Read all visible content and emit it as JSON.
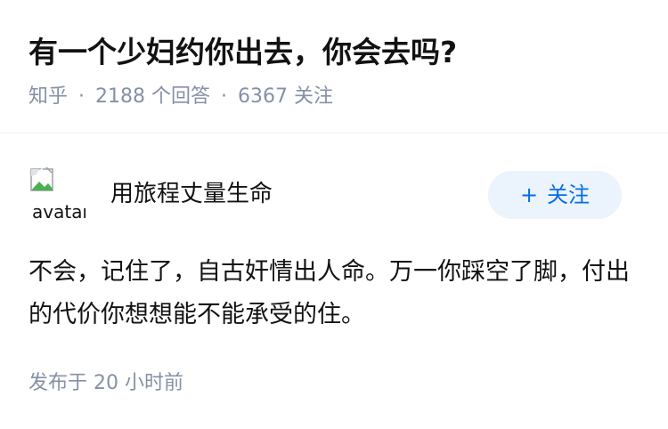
{
  "question": {
    "title": "有一个少妇约你出去，你会去吗?",
    "source": "知乎",
    "separator": "·",
    "answers_count": "2188",
    "answers_label": "个回答",
    "followers_count": "6367",
    "followers_label": "关注"
  },
  "answer": {
    "author": {
      "name": "用旅程丈量生命",
      "avatar_alt": "avatar",
      "avatar_icon": "broken-image-icon"
    },
    "follow_button": {
      "icon": "+",
      "label": "关注"
    },
    "content": "不会，记住了，自古奸情出人命。万一你踩空了脚，付出的代价你想想能不能承受的住。",
    "published": {
      "label": "发布于",
      "time": "20 小时前"
    }
  },
  "colors": {
    "text": "#121212",
    "meta": "#8590a6",
    "accent": "#056de8",
    "follow_bg": "#ebf3fd",
    "divider": "#f0f2f7"
  }
}
